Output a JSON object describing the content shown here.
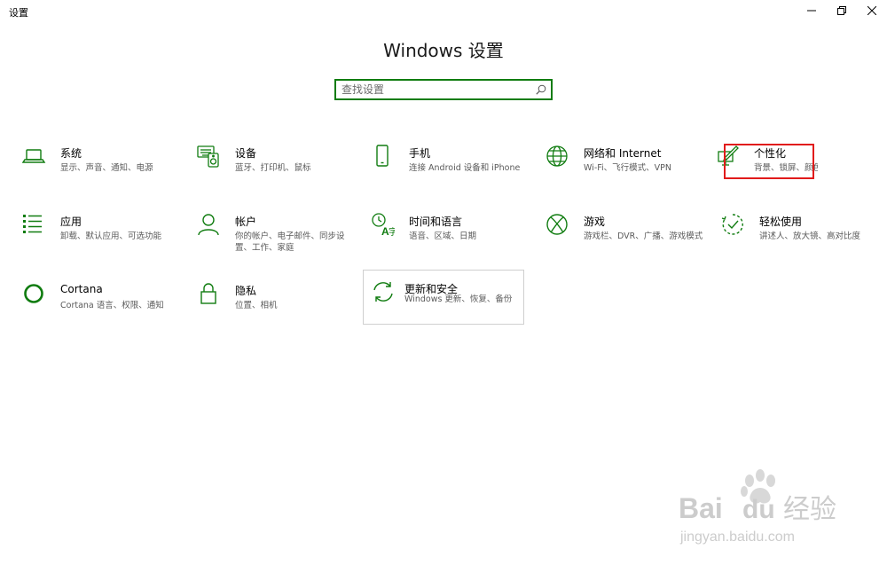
{
  "window": {
    "title": "设置"
  },
  "page": {
    "title": "Windows 设置"
  },
  "search": {
    "placeholder": "查找设置",
    "value": ""
  },
  "colors": {
    "accent": "#107c10",
    "highlight": "#e11b1b"
  },
  "tiles": [
    {
      "icon": "laptop-icon",
      "title": "系统",
      "desc": "显示、声音、通知、电源"
    },
    {
      "icon": "keyboard-speaker-icon",
      "title": "设备",
      "desc": "蓝牙、打印机、鼠标"
    },
    {
      "icon": "phone-icon",
      "title": "手机",
      "desc": "连接 Android 设备和 iPhone"
    },
    {
      "icon": "globe-icon",
      "title": "网络和 Internet",
      "desc": "Wi-Fi、飞行模式、VPN"
    },
    {
      "icon": "paintbrush-monitor-icon",
      "title": "个性化",
      "desc": "背景、锁屏、颜色"
    },
    {
      "icon": "apps-list-icon",
      "title": "应用",
      "desc": "卸载、默认应用、可选功能"
    },
    {
      "icon": "person-icon",
      "title": "帐户",
      "desc": "你的帐户、电子邮件、同步设置、工作、家庭"
    },
    {
      "icon": "time-language-icon",
      "title": "时间和语言",
      "desc": "语音、区域、日期"
    },
    {
      "icon": "xbox-icon",
      "title": "游戏",
      "desc": "游戏栏、DVR、广播、游戏模式"
    },
    {
      "icon": "ease-of-access-icon",
      "title": "轻松使用",
      "desc": "讲述人、放大镜、高对比度"
    },
    {
      "icon": "cortana-icon",
      "title": "Cortana",
      "desc": "Cortana 语言、权限、通知"
    },
    {
      "icon": "lock-icon",
      "title": "隐私",
      "desc": "位置、相机"
    },
    {
      "icon": "sync-icon",
      "title": "更新和安全",
      "desc": "Windows 更新、恢复、备份"
    }
  ],
  "watermark": {
    "brand": "Bai",
    "brand2": "du",
    "label": "经验",
    "url": "jingyan.baidu.com"
  }
}
